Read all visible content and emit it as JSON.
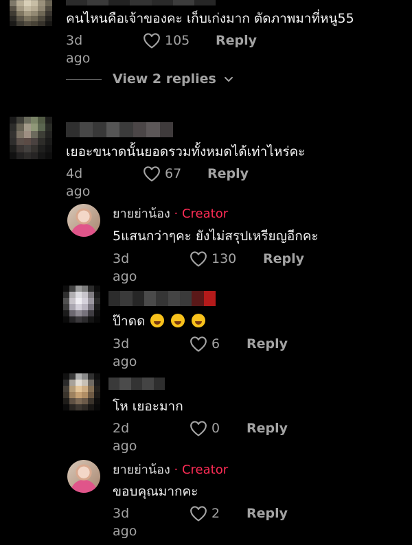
{
  "comments": [
    {
      "text": "คนไหนคือเจ้าของคะ เก็บเก่งมาก ตัดภาพมาที่หนู55",
      "time": "3d ago",
      "likes": "105",
      "reply": "Reply"
    },
    {
      "view_replies": "View 2 replies"
    },
    {
      "text": "เยอะขนาดนั้นยอดรวมทั้งหมดได้เท่าไหร่คะ",
      "time": "4d ago",
      "likes": "67",
      "reply": "Reply"
    },
    {
      "author": "ยายย่าน้อง",
      "separator": "·",
      "badge": "Creator",
      "text": "5แสนกว่าๆคะ ยังไม่สรุปเหรียญอีกคะ",
      "time": "3d ago",
      "likes": "130",
      "reply": "Reply"
    },
    {
      "text": "ป๊าดด",
      "time": "3d ago",
      "likes": "6",
      "reply": "Reply"
    },
    {
      "text": "โห เยอะมาก",
      "time": "2d ago",
      "likes": "0",
      "reply": "Reply"
    },
    {
      "author": "ยายย่าน้อง",
      "separator": "·",
      "badge": "Creator",
      "text": "ขอบคุณมากคะ",
      "time": "3d ago",
      "likes": "2",
      "reply": "Reply"
    }
  ],
  "icons": {
    "heart": "heart-outline-icon",
    "chevron": "chevron-down-icon",
    "emoji": "laughing-crying-emoji"
  },
  "colors": {
    "background": "#000000",
    "creator_badge": "#fe2c55",
    "secondary_text": "#a3a3a3"
  }
}
